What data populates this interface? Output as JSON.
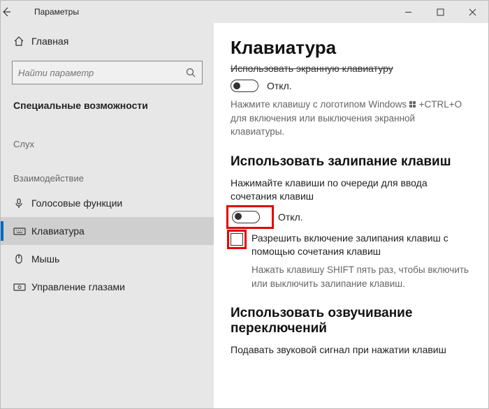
{
  "titlebar": {
    "title": "Параметры"
  },
  "sidebar": {
    "home": "Главная",
    "search_placeholder": "Найти параметр",
    "section": "Специальные возможности",
    "cat_hearing": "Слух",
    "cat_interaction": "Взаимодействие",
    "items": {
      "speech": "Голосовые функции",
      "keyboard": "Клавиатура",
      "mouse": "Мышь",
      "eye": "Управление глазами"
    }
  },
  "content": {
    "h1": "Клавиатура",
    "osk_strike": "Использовать экранную клавиатуру",
    "off": "Откл.",
    "osk_hint_a": "Нажмите клавишу с логотипом Windows ",
    "osk_hint_b": " +CTRL+О для включения или выключения экранной клавиатуры.",
    "sticky_h": "Использовать залипание клавиш",
    "sticky_desc": "Нажимайте клавиши по очереди для ввода сочетания клавиш",
    "sticky_cb": "Разрешить включение залипания клавиш с помощью сочетания клавиш",
    "sticky_hint": "Нажать клавишу SHIFT пять раз, чтобы включить или выключить залипание клавиш.",
    "toggle_h": "Использовать озвучивание переключений",
    "toggle_desc": "Подавать звуковой сигнал при нажатии клавиш"
  }
}
